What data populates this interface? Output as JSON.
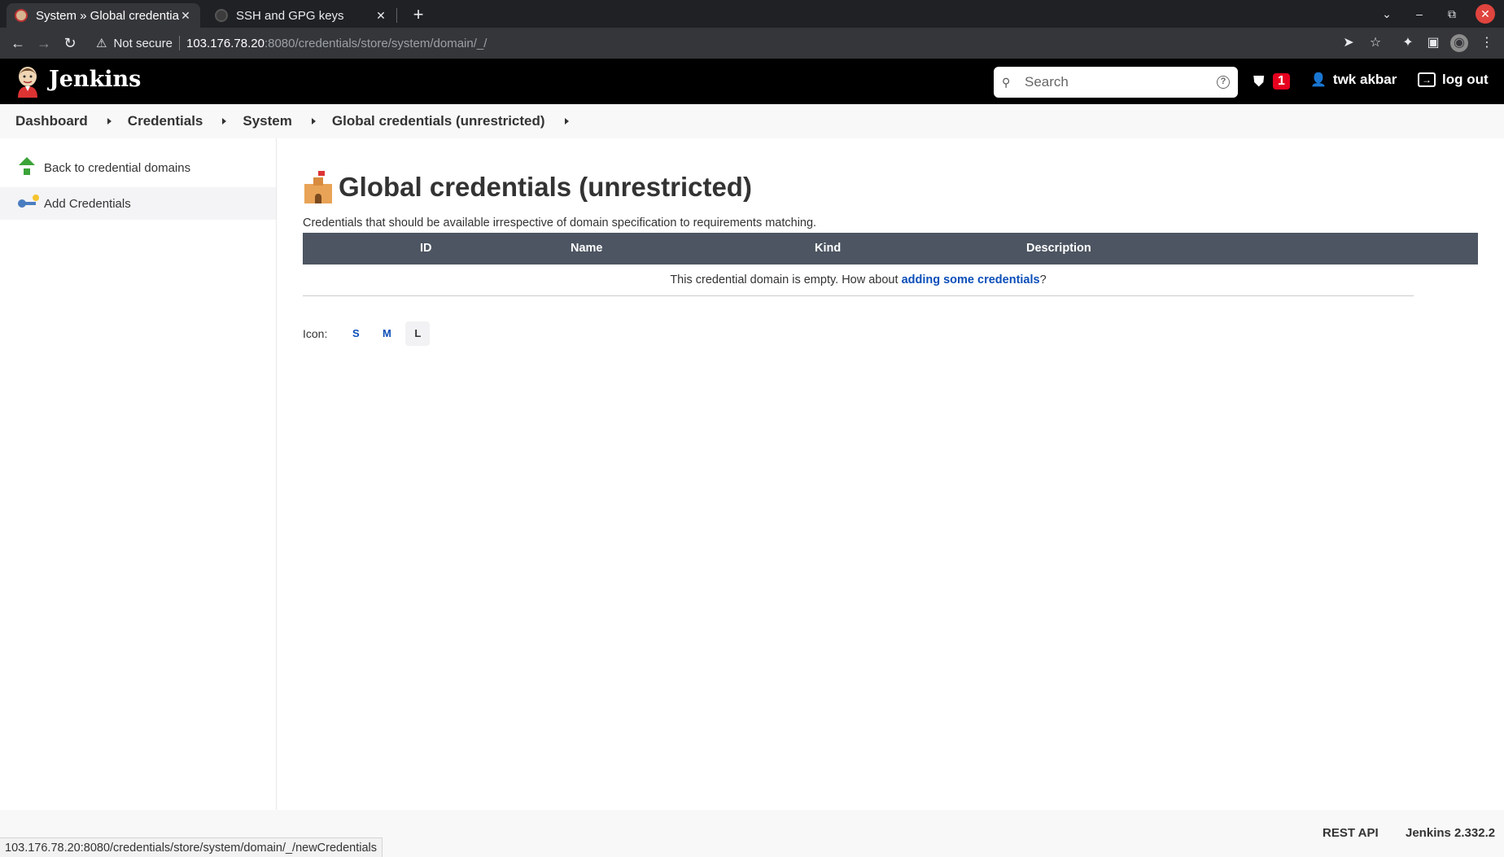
{
  "browser": {
    "tabs": [
      {
        "title": "System » Global credentia",
        "active": true
      },
      {
        "title": "SSH and GPG keys",
        "active": false
      }
    ],
    "new_tab": "+",
    "nav": {
      "back": "←",
      "forward": "→",
      "reload": "↻"
    },
    "security_warning": "Not secure",
    "url_host": "103.176.78.20",
    "url_path": ":8080/credentials/store/system/domain/_/",
    "status_url": "103.176.78.20:8080/credentials/store/system/domain/_/newCredentials",
    "window_controls": {
      "dropdown": "⌄",
      "minimize": "–",
      "restore": "⧉",
      "close": "✕"
    }
  },
  "header": {
    "title": "Jenkins",
    "search_placeholder": "Search",
    "help": "?",
    "security_count": "1",
    "user": "twk akbar",
    "logout": "log out"
  },
  "breadcrumbs": [
    "Dashboard",
    "Credentials",
    "System",
    "Global credentials (unrestricted)"
  ],
  "sidepanel": {
    "items": [
      {
        "label": "Back to credential domains",
        "icon": "green-up-arrow-icon"
      },
      {
        "label": "Add Credentials",
        "icon": "key-icon"
      }
    ]
  },
  "main": {
    "title": "Global credentials (unrestricted)",
    "description": "Credentials that should be available irrespective of domain specification to requirements matching.",
    "columns": [
      "ID",
      "Name",
      "Kind",
      "Description"
    ],
    "empty_prefix": "This credential domain is empty. How about ",
    "empty_link": "adding some credentials",
    "empty_suffix": "?",
    "icon_size_label": "Icon:",
    "icon_sizes": [
      "S",
      "M",
      "L"
    ],
    "icon_size_selected": "L"
  },
  "footer": {
    "rest_api": "REST API",
    "version": "Jenkins 2.332.2"
  },
  "colors": {
    "header_bg": "#000000",
    "table_header_bg": "#4c5561",
    "link": "#0b4eb8",
    "badge": "#e6001f"
  }
}
